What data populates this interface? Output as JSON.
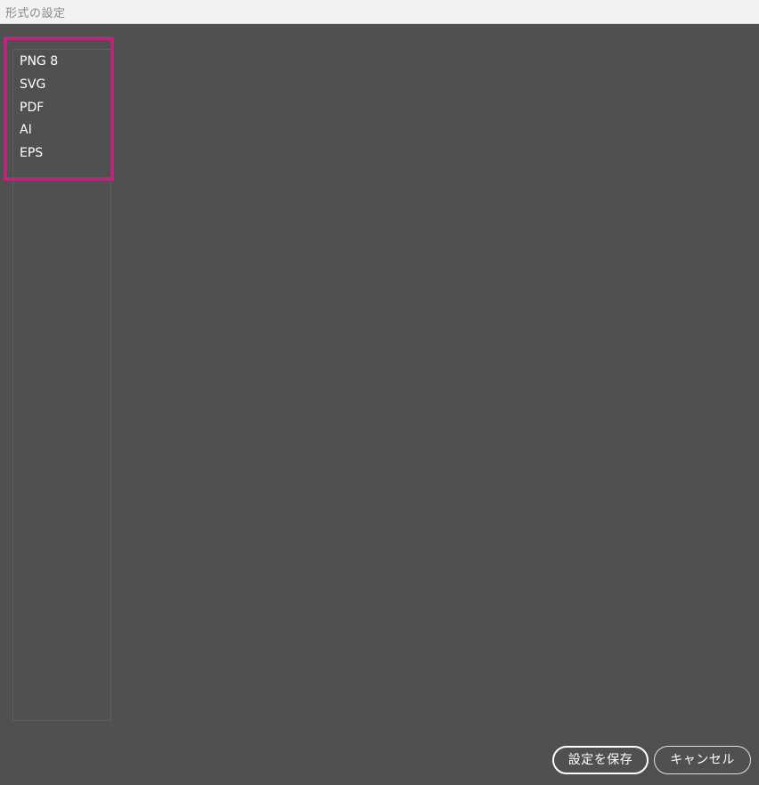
{
  "window": {
    "title": "形式の設定"
  },
  "formats": [
    {
      "label": "PNG 8"
    },
    {
      "label": "SVG"
    },
    {
      "label": "PDF"
    },
    {
      "label": "AI"
    },
    {
      "label": "EPS"
    }
  ],
  "buttons": {
    "save_label": "設定を保存",
    "cancel_label": "キャンセル"
  },
  "colors": {
    "background": "#505050",
    "highlight": "#b5287b",
    "titlebar": "#f2f2f2"
  }
}
